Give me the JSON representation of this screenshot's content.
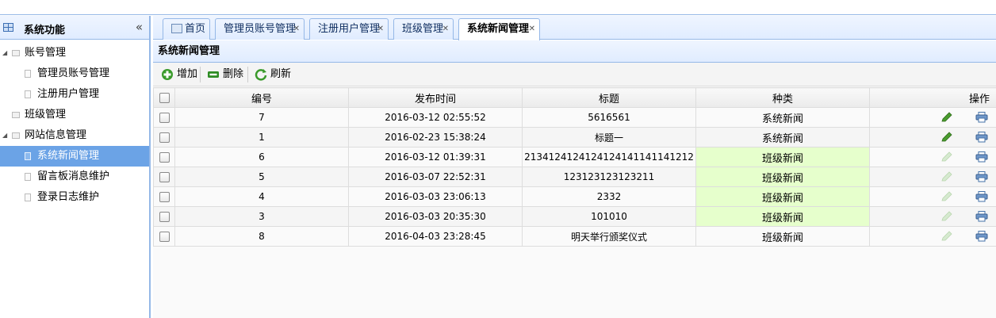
{
  "sidebar": {
    "title": "系统功能",
    "collapse_glyph": "«",
    "items": [
      {
        "label": "账号管理",
        "level": 0,
        "expanded": true
      },
      {
        "label": "管理员账号管理",
        "level": 1
      },
      {
        "label": "注册用户管理",
        "level": 1
      },
      {
        "label": "班级管理",
        "level": 0
      },
      {
        "label": "网站信息管理",
        "level": 0,
        "expanded": true
      },
      {
        "label": "系统新闻管理",
        "level": 1,
        "selected": true
      },
      {
        "label": "留言板消息维护",
        "level": 1
      },
      {
        "label": "登录日志维护",
        "level": 1
      }
    ]
  },
  "tabs": [
    {
      "label": "首页",
      "closable": false
    },
    {
      "label": "管理员账号管理",
      "closable": true
    },
    {
      "label": "注册用户管理",
      "closable": true
    },
    {
      "label": "班级管理",
      "closable": true
    },
    {
      "label": "系统新闻管理",
      "closable": true,
      "active": true
    }
  ],
  "panel": {
    "title": "系统新闻管理"
  },
  "toolbar": {
    "add_label": "增加",
    "delete_label": "删除",
    "refresh_label": "刷新"
  },
  "grid": {
    "columns": [
      "编号",
      "发布时间",
      "标题",
      "种类",
      "操作"
    ],
    "rows": [
      {
        "id": "7",
        "time": "2016-03-12 02:55:52",
        "title": "5616561",
        "kind": "系统新闻",
        "edit_enabled": true
      },
      {
        "id": "1",
        "time": "2016-02-23 15:38:24",
        "title": "标题一",
        "kind": "系统新闻",
        "edit_enabled": true
      },
      {
        "id": "6",
        "time": "2016-03-12 01:39:31",
        "title": "2134124124124124141141141212",
        "kind": "班级新闻",
        "highlight": true,
        "edit_enabled": false
      },
      {
        "id": "5",
        "time": "2016-03-07 22:52:31",
        "title": "123123123123211",
        "kind": "班级新闻",
        "highlight": true,
        "edit_enabled": false
      },
      {
        "id": "4",
        "time": "2016-03-03 23:06:13",
        "title": "2332",
        "kind": "班级新闻",
        "highlight": true,
        "edit_enabled": false
      },
      {
        "id": "3",
        "time": "2016-03-03 20:35:30",
        "title": "101010",
        "kind": "班级新闻",
        "highlight": true,
        "edit_enabled": false
      },
      {
        "id": "8",
        "time": "2016-04-03 23:28:45",
        "title": "明天举行颁奖仪式",
        "kind": "班级新闻",
        "highlight": false,
        "edit_enabled": false
      }
    ]
  },
  "colors": {
    "accent": "#95b8e7",
    "selected": "#6ba3e6",
    "highlight": "#e6ffcc"
  }
}
